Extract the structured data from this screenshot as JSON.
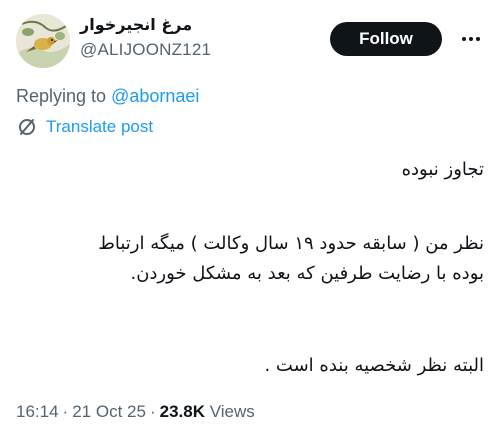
{
  "author": {
    "display_name": "مرغ انجیرخوار",
    "handle": "@ALIJOONZ121"
  },
  "follow_button": {
    "label": "Follow"
  },
  "reply_context": {
    "prefix": "Replying to ",
    "mention": "@abornaei"
  },
  "translate": {
    "label": "Translate post",
    "icon": "translate-icon"
  },
  "tweet": {
    "lines": [
      "تجاوز نبوده",
      "نظر من ( سابقه حدود ۱۹ سال وکالت ) میگه ارتباط",
      "بوده با رضایت طرفین که بعد به مشکل خوردن.",
      "البته نظر شخصیه بنده است ."
    ]
  },
  "meta": {
    "time": "16:14",
    "date": "21 Oct 25",
    "separator": "·",
    "views_count": "23.8K",
    "views_label": "Views"
  },
  "colors": {
    "link": "#1d9bf0",
    "text": "#0f1419",
    "secondary": "#536471",
    "button_bg": "#0f1419"
  }
}
